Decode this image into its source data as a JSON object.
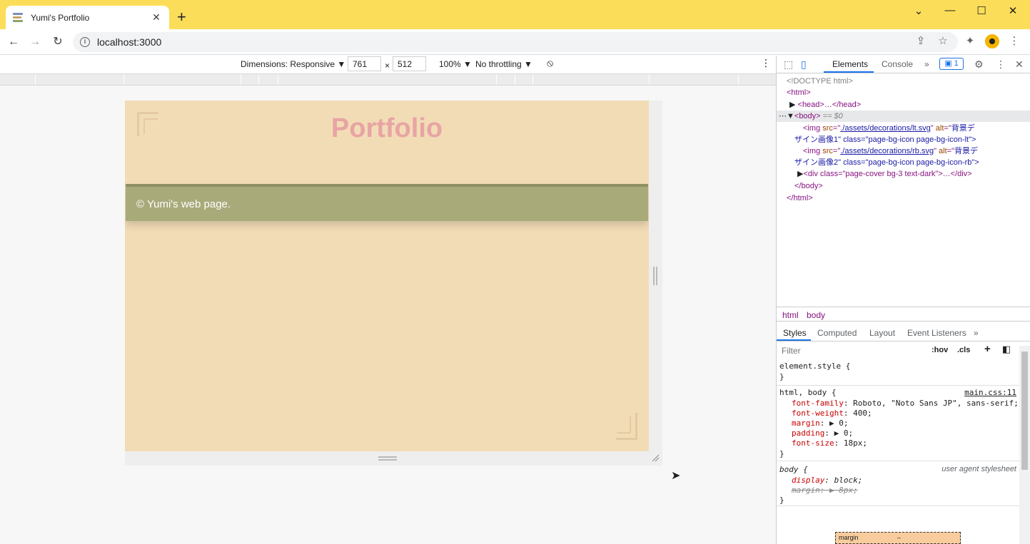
{
  "browser": {
    "tab": {
      "title": "Yumi's Portfolio",
      "close": "✕"
    },
    "new_tab": "+",
    "window_controls": {
      "dropdown": "⌄",
      "minimize": "—",
      "maximize": "☐",
      "close": "✕"
    },
    "url": "localhost:3000",
    "nav": {
      "back": "←",
      "forward": "→",
      "reload": "↻"
    }
  },
  "device_toolbar": {
    "dimensions_label": "Dimensions: Responsive ▼",
    "width": "761",
    "times": "×",
    "height": "512",
    "zoom": "100% ▼",
    "throttling": "No throttling ▼",
    "more": "⋮"
  },
  "page": {
    "title": "Portfolio",
    "footer": "© Yumi's web page."
  },
  "devtools": {
    "tabs": [
      "Elements",
      "Console"
    ],
    "more_tabs": "»",
    "issues_count": "1",
    "dom": {
      "doctype": "<!DOCTYPE html>",
      "html_open": "<html>",
      "head": "<head>…</head>",
      "body_open": "<body>",
      "body_eq": " == $0",
      "img1_src": "./assets/decorations/lt.svg",
      "img1_alt": "背景デ",
      "img1_cont": "ザイン画像1\" class=\"page-bg-icon page-bg-icon-lt\">",
      "img2_src": "./assets/decorations/rb.svg",
      "img2_alt": "背景デ",
      "img2_cont": "ザイン画像2\" class=\"page-bg-icon page-bg-icon-rb\">",
      "div_line": "<div class=\"page-cover bg-3 text-dark\">…</div>",
      "body_close": "</body>",
      "html_close": "</html>"
    },
    "breadcrumbs": [
      "html",
      "body"
    ],
    "sub_tabs": [
      "Styles",
      "Computed",
      "Layout",
      "Event Listeners"
    ],
    "sub_more": "»",
    "filter_placeholder": "Filter",
    "hov": ":hov",
    "cls": ".cls",
    "styles": {
      "element_style": "element.style {",
      "close": "}",
      "rule2_selector": "html, body {",
      "rule2_source": "main.css:11",
      "rule2_props": [
        {
          "name": "font-family",
          "value": "Roboto, \"Noto Sans JP\", sans-serif;"
        },
        {
          "name": "font-weight",
          "value": "400;"
        },
        {
          "name": "margin",
          "value": "▶ 0;"
        },
        {
          "name": "padding",
          "value": "▶ 0;"
        },
        {
          "name": "font-size",
          "value": "18px;"
        }
      ],
      "rule3_selector": "body {",
      "rule3_source": "user agent stylesheet",
      "rule3_props": [
        {
          "name": "display",
          "value": "block;"
        },
        {
          "name": "margin",
          "value": "▶ 8px;"
        }
      ]
    },
    "box_model": {
      "label": "margin",
      "value": "–"
    }
  }
}
